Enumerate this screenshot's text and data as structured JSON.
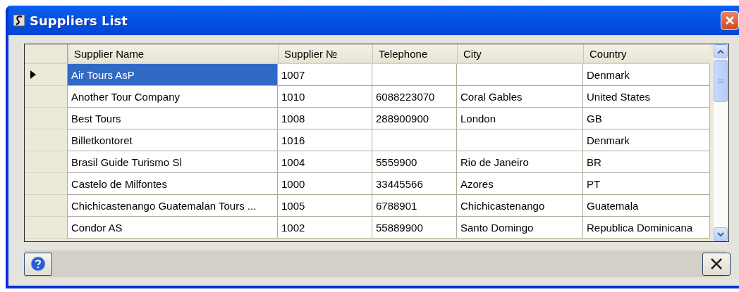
{
  "window": {
    "title": "Suppliers List"
  },
  "table": {
    "columns": [
      "Supplier Name",
      "Supplier №",
      "Telephone",
      "City",
      "Country"
    ],
    "rows": [
      {
        "selected": true,
        "cells": [
          "Air Tours AsP",
          "1007",
          "",
          "",
          "Denmark"
        ]
      },
      {
        "selected": false,
        "cells": [
          "Another Tour Company",
          "1010",
          "6088223070",
          "Coral Gables",
          "United States"
        ]
      },
      {
        "selected": false,
        "cells": [
          "Best Tours",
          "1008",
          "288900900",
          "London",
          "GB"
        ]
      },
      {
        "selected": false,
        "cells": [
          "Billetkontoret",
          "1016",
          "",
          "",
          "Denmark"
        ]
      },
      {
        "selected": false,
        "cells": [
          "Brasil Guide Turismo Sl",
          "1004",
          "5559900",
          "Rio de Janeiro",
          "BR"
        ]
      },
      {
        "selected": false,
        "cells": [
          "Castelo de Milfontes",
          "1000",
          "33445566",
          "Azores",
          "PT"
        ]
      },
      {
        "selected": false,
        "cells": [
          "Chichicastenango Guatemalan Tours ...",
          "1005",
          "6788901",
          "Chichicastenango",
          "Guatemala"
        ]
      },
      {
        "selected": false,
        "cells": [
          "Condor AS",
          "1002",
          "55889900",
          "Santo Domingo",
          "Republica Dominicana"
        ]
      }
    ]
  }
}
